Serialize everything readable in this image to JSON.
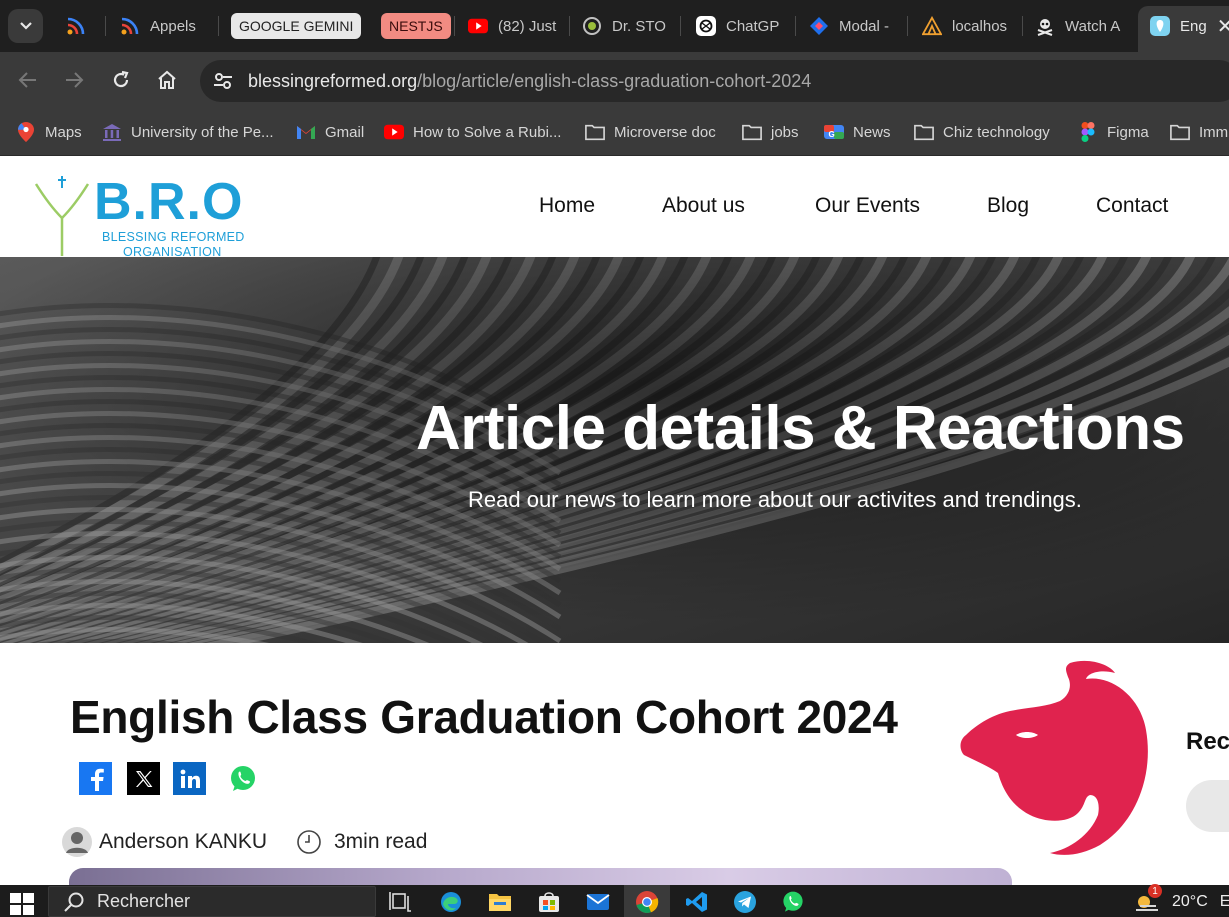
{
  "browser": {
    "tabs": [
      {
        "label": ""
      },
      {
        "label": "Appels"
      },
      {
        "label": "(82) Just"
      },
      {
        "label": "Dr. STO"
      },
      {
        "label": "ChatGP"
      },
      {
        "label": "Modal -"
      },
      {
        "label": "localhos"
      },
      {
        "label": "Watch A"
      },
      {
        "label": "Eng"
      }
    ],
    "tab_groups": [
      {
        "label": "GOOGLE GEMINI",
        "color": "#e8e8e8"
      },
      {
        "label": "NESTJS",
        "color": "#f28b82"
      }
    ],
    "url_host": "blessingreformed.org",
    "url_path": "/blog/article/english-class-graduation-cohort-2024",
    "bookmarks": [
      {
        "label": "Maps",
        "icon": "maps-icon"
      },
      {
        "label": "University of the Pe...",
        "icon": "university-icon"
      },
      {
        "label": "Gmail",
        "icon": "gmail-icon"
      },
      {
        "label": "How to Solve a Rubi...",
        "icon": "youtube-icon"
      },
      {
        "label": "Microverse doc",
        "icon": "folder-icon"
      },
      {
        "label": "jobs",
        "icon": "folder-icon"
      },
      {
        "label": "News",
        "icon": "news-icon"
      },
      {
        "label": "Chiz technology",
        "icon": "folder-icon"
      },
      {
        "label": "Figma",
        "icon": "figma-icon"
      },
      {
        "label": "Imm",
        "icon": "folder-icon"
      }
    ]
  },
  "site": {
    "logo": {
      "text": "B.R.O",
      "sub1": "BLESSING REFORMED",
      "sub2": "ORGANISATION"
    },
    "nav": [
      "Home",
      "About us",
      "Our Events",
      "Blog",
      "Contact"
    ],
    "hero": {
      "title": "Article details & Reactions",
      "subtitle": "Read our news to learn more about our activites and trendings."
    },
    "article": {
      "title": "English Class Graduation Cohort 2024",
      "author": "Anderson KANKU",
      "read_time": "3min read"
    },
    "sidebar": {
      "recent_label": "Rec"
    }
  },
  "taskbar": {
    "search_placeholder": "Rechercher",
    "temperature": "20°C",
    "notification_count": "1",
    "weather_trailing": "E"
  },
  "colors": {
    "brand_blue": "#1e9fd8",
    "nest_red": "#e0234e",
    "facebook": "#1877f2",
    "linkedin": "#0a66c2",
    "whatsapp": "#25d366"
  }
}
